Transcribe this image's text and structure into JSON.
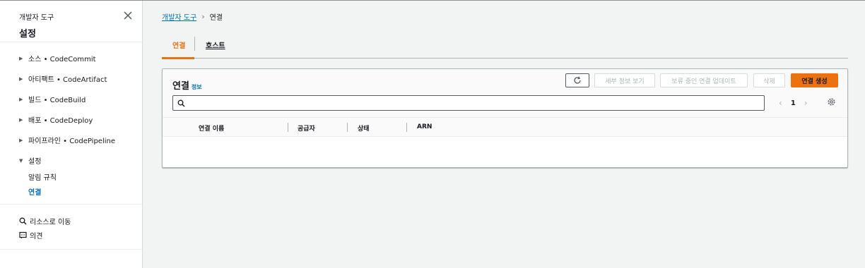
{
  "sidebar": {
    "service": "개발자 도구",
    "title": "설정",
    "sections": [
      {
        "label": "소스 • CodeCommit"
      },
      {
        "label": "아티팩트 • CodeArtifact"
      },
      {
        "label": "빌드 • CodeBuild"
      },
      {
        "label": "배포 • CodeDeploy"
      },
      {
        "label": "파이프라인 • CodePipeline"
      },
      {
        "label": "설정"
      }
    ],
    "settings_items": [
      "알림 규칙",
      "연결"
    ],
    "utilities": [
      {
        "label": "리소스로 이동",
        "icon": "search-icon"
      },
      {
        "label": "의견",
        "icon": "feedback-icon"
      }
    ]
  },
  "breadcrumb": {
    "root": "개발자 도구",
    "current": "연결"
  },
  "tabs": [
    "연결",
    "호스트"
  ],
  "panel": {
    "title": "연결",
    "info": "정보",
    "buttons": {
      "details": "세부 정보 보기",
      "update": "보류 중인 연결 업데이트",
      "delete": "삭제",
      "create": "연결 생성"
    },
    "search_value": "",
    "page": "1",
    "columns": [
      "연결 이름",
      "공급자",
      "상태",
      "ARN"
    ]
  },
  "colors": {
    "accent": "#ec7211",
    "link": "#0073bb",
    "disabled": "#aab7b8"
  }
}
